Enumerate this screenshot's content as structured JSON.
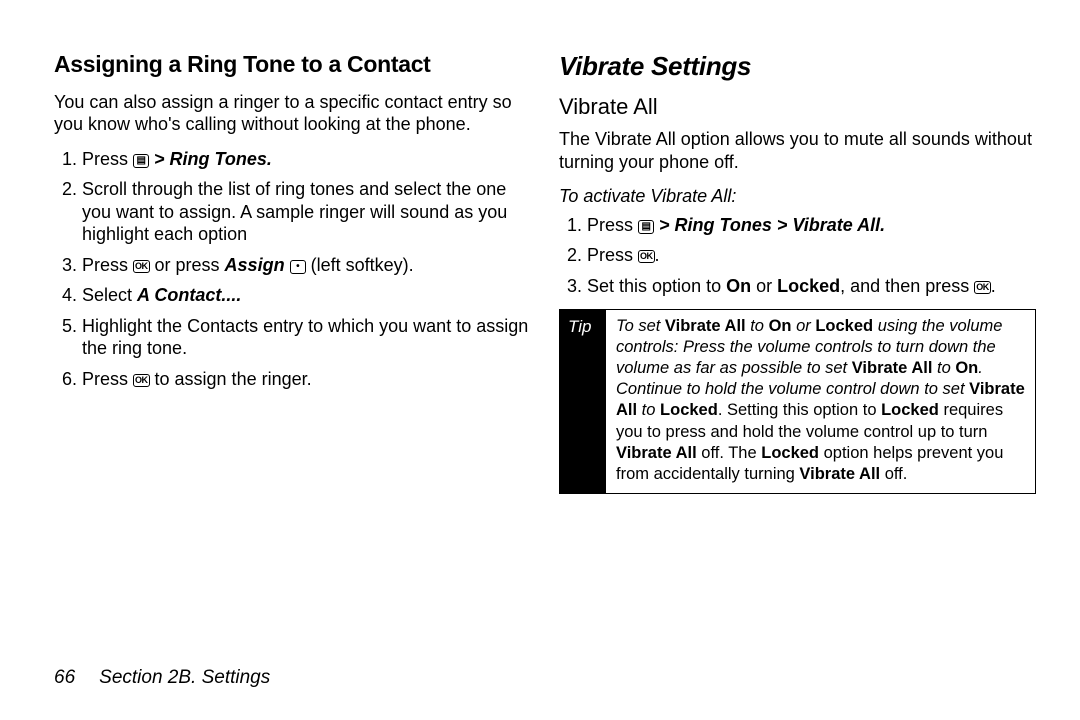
{
  "left": {
    "heading": "Assigning a Ring Tone to a Contact",
    "intro": "You can also assign a ringer to a specific contact entry so you know who's calling without looking at the phone.",
    "step1_a": "Press ",
    "step1_b": " > ",
    "step1_c": "Ring Tones.",
    "step2": "Scroll through the list of ring tones and select the one you want to assign. A sample ringer will sound as you highlight each option",
    "step3_a": "Press ",
    "step3_b": " or press ",
    "step3_assign": "Assign",
    "step3_c": " (left softkey).",
    "step4_a": "Select ",
    "step4_b": "A Contact....",
    "step5": "Highlight the Contacts entry to which you want to assign the ring tone.",
    "step6_a": "Press ",
    "step6_b": " to assign the ringer."
  },
  "right": {
    "section": "Vibrate Settings",
    "sub": "Vibrate All",
    "intro": "The Vibrate All option allows you to mute all sounds without turning your phone off.",
    "instr": "To activate Vibrate All:",
    "step1_a": "Press ",
    "step1_b": " > ",
    "step1_c": "Ring Tones",
    "step1_d": " > ",
    "step1_e": "Vibrate All",
    "step1_f": ".",
    "step2_a": "Press ",
    "step2_b": ".",
    "step3_a": "Set this option to ",
    "step3_on": "On",
    "step3_b": " or ",
    "step3_locked": "Locked",
    "step3_c": ", and then press ",
    "step3_d": "."
  },
  "tip": {
    "label": "Tip",
    "t1": "To set ",
    "va": "Vibrate All",
    "t2": " to ",
    "on": "On",
    "t3": " or ",
    "locked": "Locked",
    "t4": " using the volume controls: Press the volume controls to turn down the volume as far as possible to set ",
    "t5": " to ",
    "t6": ". Continue to hold the volume control down to set ",
    "t7": " to ",
    "t8": ".  Setting this option to ",
    "t9": " requires you to press and hold the volume control up to turn ",
    "t10": " off. The ",
    "t11": " option helps prevent you from accidentally turning ",
    "t12": " off."
  },
  "footer": {
    "page": "66",
    "section": "Section 2B. Settings"
  },
  "icons": {
    "menu": "▤",
    "ok": "OK"
  }
}
